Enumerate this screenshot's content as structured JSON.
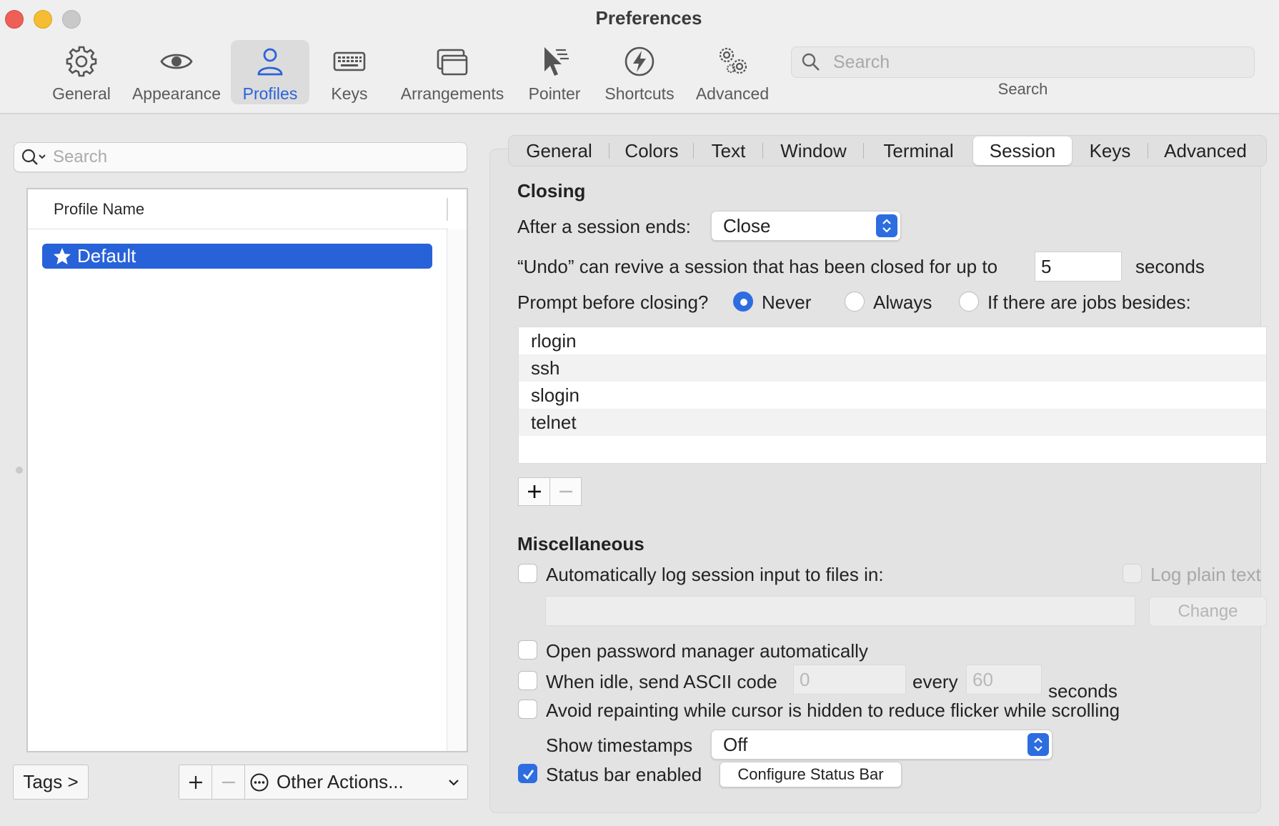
{
  "window": {
    "title": "Preferences"
  },
  "toolbar": {
    "items": [
      {
        "label": "General",
        "icon": "gear-icon"
      },
      {
        "label": "Appearance",
        "icon": "eye-icon"
      },
      {
        "label": "Profiles",
        "icon": "person-icon",
        "selected": true
      },
      {
        "label": "Keys",
        "icon": "keyboard-icon"
      },
      {
        "label": "Arrangements",
        "icon": "windows-icon"
      },
      {
        "label": "Pointer",
        "icon": "pointer-icon"
      },
      {
        "label": "Shortcuts",
        "icon": "bolt-icon"
      },
      {
        "label": "Advanced",
        "icon": "gears-icon"
      }
    ],
    "search_placeholder": "Search",
    "search_label": "Search"
  },
  "profiles": {
    "search_placeholder": "Search",
    "column_header": "Profile Name",
    "items": [
      {
        "name": "Default",
        "selected": true,
        "default": true
      }
    ],
    "tags_button": "Tags >",
    "other_actions": "Other Actions..."
  },
  "tabs": {
    "items": [
      {
        "label": "General"
      },
      {
        "label": "Colors"
      },
      {
        "label": "Text"
      },
      {
        "label": "Window"
      },
      {
        "label": "Terminal"
      },
      {
        "label": "Session",
        "selected": true
      },
      {
        "label": "Keys"
      },
      {
        "label": "Advanced"
      }
    ]
  },
  "closing": {
    "title": "Closing",
    "after_session_label": "After a session ends:",
    "after_session_value": "Close",
    "undo_label": "“Undo” can revive a session that has been closed for up to",
    "undo_value": "5",
    "undo_unit": "seconds",
    "prompt_label": "Prompt before closing?",
    "prompt_options": [
      {
        "label": "Never",
        "checked": true
      },
      {
        "label": "Always",
        "checked": false
      },
      {
        "label": "If there are jobs besides:",
        "checked": false
      }
    ],
    "jobs": [
      "rlogin",
      "ssh",
      "slogin",
      "telnet"
    ]
  },
  "misc": {
    "title": "Miscellaneous",
    "log_label": "Automatically log session input to files in:",
    "log_checked": false,
    "log_plain_label": "Log plain text",
    "log_path": "",
    "change_button": "Change",
    "password_manager_label": "Open password manager automatically",
    "idle_label": "When idle, send ASCII code",
    "idle_code_value": "0",
    "idle_every_label": "every",
    "idle_seconds_value": "60",
    "idle_unit": "seconds",
    "repaint_label": "Avoid repainting while cursor is hidden to reduce flicker while scrolling",
    "timestamps_label": "Show timestamps",
    "timestamps_value": "Off",
    "status_bar_label": "Status bar enabled",
    "status_bar_checked": true,
    "configure_status_bar": "Configure Status Bar"
  },
  "colors": {
    "accent": "#2d6de0",
    "selection": "#2862d8",
    "close": "#ee5f57",
    "minimize": "#f5bd31",
    "zoom": "#c9c9c9"
  }
}
